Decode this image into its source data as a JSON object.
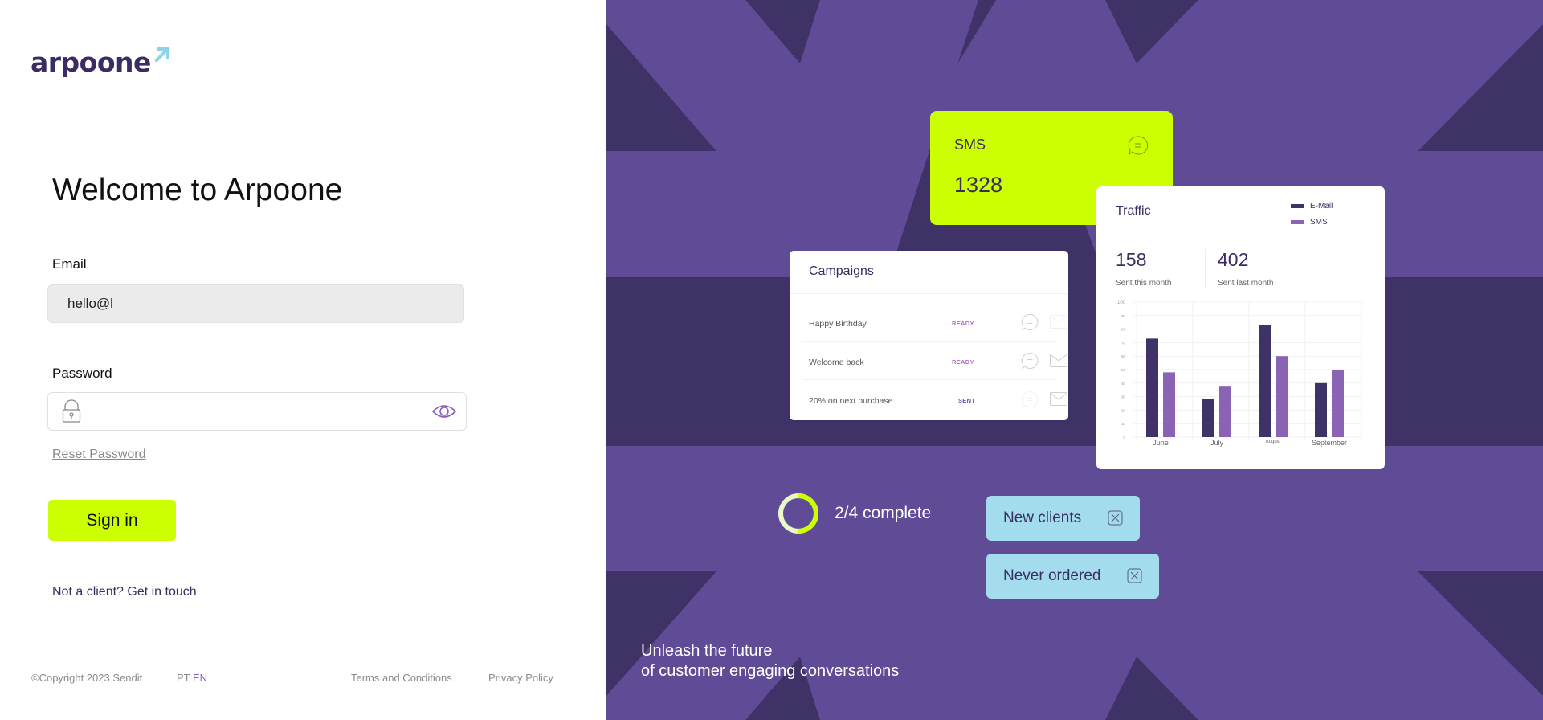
{
  "brand": {
    "logo_text": "arpoone",
    "colors": {
      "primary_dark": "#3b2d63",
      "accent_lime": "#ccff00",
      "accent_purple": "#8a5fb8",
      "bg_dark": "#3f3266",
      "bg_light": "#5f4b96",
      "tag_blue": "#a3dced",
      "logo_arrow": "#8fd3e8"
    }
  },
  "login": {
    "title": "Welcome to Arpoone",
    "email_label": "Email",
    "email_value": "hello@l",
    "password_label": "Password",
    "password_value": "",
    "reset_password": "Reset Password",
    "sign_in": "Sign in",
    "not_client": "Not a client? Get in touch"
  },
  "footer": {
    "copyright": "©Copyright 2023 Sendit",
    "lang_pt": "PT",
    "lang_en": "EN",
    "terms": "Terms and Conditions",
    "privacy": "Privacy Policy"
  },
  "showcase": {
    "sms_card": {
      "title": "SMS",
      "value": "1328",
      "icon": "chat-bubble-icon"
    },
    "campaigns": {
      "title": "Campaigns",
      "rows": [
        {
          "name": "Happy Birthday",
          "status": "READY",
          "status_color": "#b06fc4",
          "chat_active": true,
          "mail_active": false
        },
        {
          "name": "Welcome back",
          "status": "READY",
          "status_color": "#b06fc4",
          "chat_active": true,
          "mail_active": true
        },
        {
          "name": "20% on next purchase",
          "status": "SENT",
          "status_color": "#6a4fb0",
          "chat_active": false,
          "mail_active": true
        }
      ]
    },
    "traffic": {
      "title": "Traffic",
      "legend": [
        {
          "label": "E-Mail",
          "color": "#3f3266"
        },
        {
          "label": "SMS",
          "color": "#8a63b5"
        }
      ],
      "stats": [
        {
          "value": "158",
          "caption": "Sent this month"
        },
        {
          "value": "402",
          "caption": "Sent last month"
        }
      ]
    },
    "progress": {
      "text": "2/4 complete",
      "fraction": 0.5
    },
    "tags": [
      {
        "label": "New clients"
      },
      {
        "label": "Never ordered"
      }
    ],
    "tagline": [
      "Unleash the future",
      "of customer engaging conversations"
    ]
  },
  "chart_data": {
    "type": "bar",
    "title": "Traffic",
    "categories": [
      "June",
      "July",
      "August",
      "September"
    ],
    "series": [
      {
        "name": "E-Mail",
        "values": [
          73,
          28,
          83,
          40
        ]
      },
      {
        "name": "SMS",
        "values": [
          48,
          38,
          60,
          50
        ]
      }
    ],
    "yticks": [
      0,
      10,
      20,
      30,
      40,
      50,
      60,
      70,
      80,
      90,
      100
    ],
    "ylim": [
      0,
      100
    ],
    "xlabel": "",
    "ylabel": "",
    "grid": true,
    "legend": "top-right"
  }
}
